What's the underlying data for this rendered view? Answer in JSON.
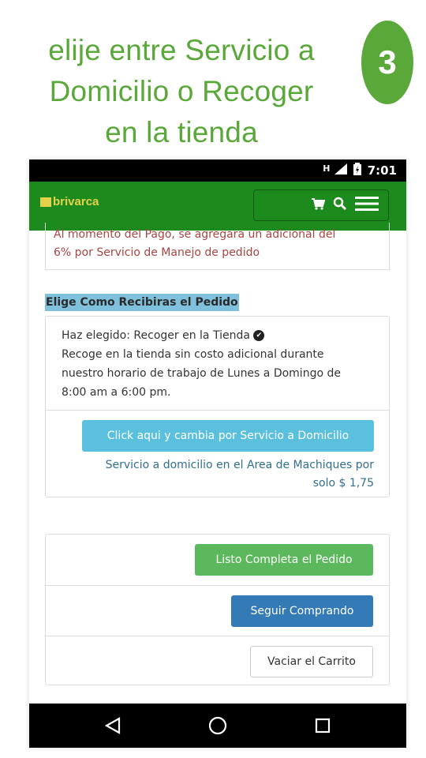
{
  "heading": {
    "line1": "elije entre Servicio a",
    "line2": "Domicilio o Recoger",
    "line3": "en la tienda"
  },
  "step": "3",
  "statusbar": {
    "signal": "H",
    "time": "7:01"
  },
  "navbar": {
    "logo": "brivarca",
    "icons": [
      "cart-icon",
      "search-icon",
      "menu-icon"
    ]
  },
  "notice": {
    "line1": "Al momento del Pago, se agregara un adicional del",
    "line2": "6% por Servicio de Manejo de pedido"
  },
  "delivery": {
    "section_title": "Elige Como Recibiras el Pedido",
    "chosen": "Haz elegido: Recoger en la Tienda",
    "desc_line1": "Recoge en la tienda sin costo adicional durante",
    "desc_line2": "nuestro horario de trabajo de Lunes a Domingo de",
    "desc_line3": "8:00 am a 6:00 pm.",
    "switch_button": "Click aqui y cambia por Servicio a Domicilio",
    "note_line1": "Servicio a domicilio en el Area de Machiques por",
    "note_line2": "solo $ 1,75"
  },
  "actions": {
    "complete": "Listo Completa el Pedido",
    "continue": "Seguir Comprando",
    "empty": "Vaciar el Carrito"
  },
  "colors": {
    "heading": "#5aa83a",
    "navbar": "#1c8a1c",
    "info": "#5bc0de",
    "success": "#5cb85c",
    "primary": "#337ab7",
    "danger_text": "#a94442"
  }
}
